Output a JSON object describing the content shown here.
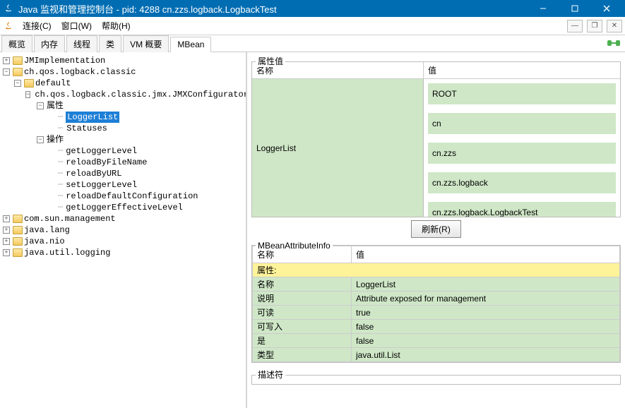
{
  "window": {
    "title": "Java 监视和管理控制台 - pid: 4288 cn.zzs.logback.LogbackTest"
  },
  "menu": {
    "connect": "连接(C)",
    "window": "窗口(W)",
    "help": "帮助(H)"
  },
  "tabs": {
    "overview": "概览",
    "memory": "内存",
    "threads": "线程",
    "classes": "类",
    "vm": "VM 概要",
    "mbean": "MBean"
  },
  "tree": {
    "jmimpl": "JMImplementation",
    "logback_classic": "ch.qos.logback.classic",
    "default": "default",
    "jmxconfig": "ch.qos.logback.classic.jmx.JMXConfigurator",
    "attributes": "属性",
    "loggerlist": "LoggerList",
    "statuses": "Statuses",
    "operations": "操作",
    "op_getLoggerLevel": "getLoggerLevel",
    "op_reloadByFileName": "reloadByFileName",
    "op_reloadByURL": "reloadByURL",
    "op_setLoggerLevel": "setLoggerLevel",
    "op_reloadDefaultConfiguration": "reloadDefaultConfiguration",
    "op_getLoggerEffectiveLevel": "getLoggerEffectiveLevel",
    "com_sun_management": "com.sun.management",
    "java_lang": "java.lang",
    "java_nio": "java.nio",
    "java_util_logging": "java.util.logging"
  },
  "attrval": {
    "section_title": "属性值",
    "col_name": "名称",
    "col_value": "值",
    "name": "LoggerList",
    "values": [
      "ROOT",
      "cn",
      "cn.zzs",
      "cn.zzs.logback",
      "cn.zzs.logback.LogbackTest"
    ],
    "refresh": "刷新(R)"
  },
  "mbeaninfo": {
    "section_title": "MBeanAttributeInfo",
    "col_name": "名称",
    "col_value": "值",
    "rows": {
      "attr_label": "属性:",
      "name_label": "名称",
      "name_value": "LoggerList",
      "desc_label": "说明",
      "desc_value": "Attribute exposed for management",
      "readable_label": "可读",
      "readable_value": "true",
      "writable_label": "可写入",
      "writable_value": "false",
      "is_label": "是",
      "is_value": "false",
      "type_label": "类型",
      "type_value": "java.util.List"
    }
  },
  "descriptor": {
    "title": "描述符"
  }
}
